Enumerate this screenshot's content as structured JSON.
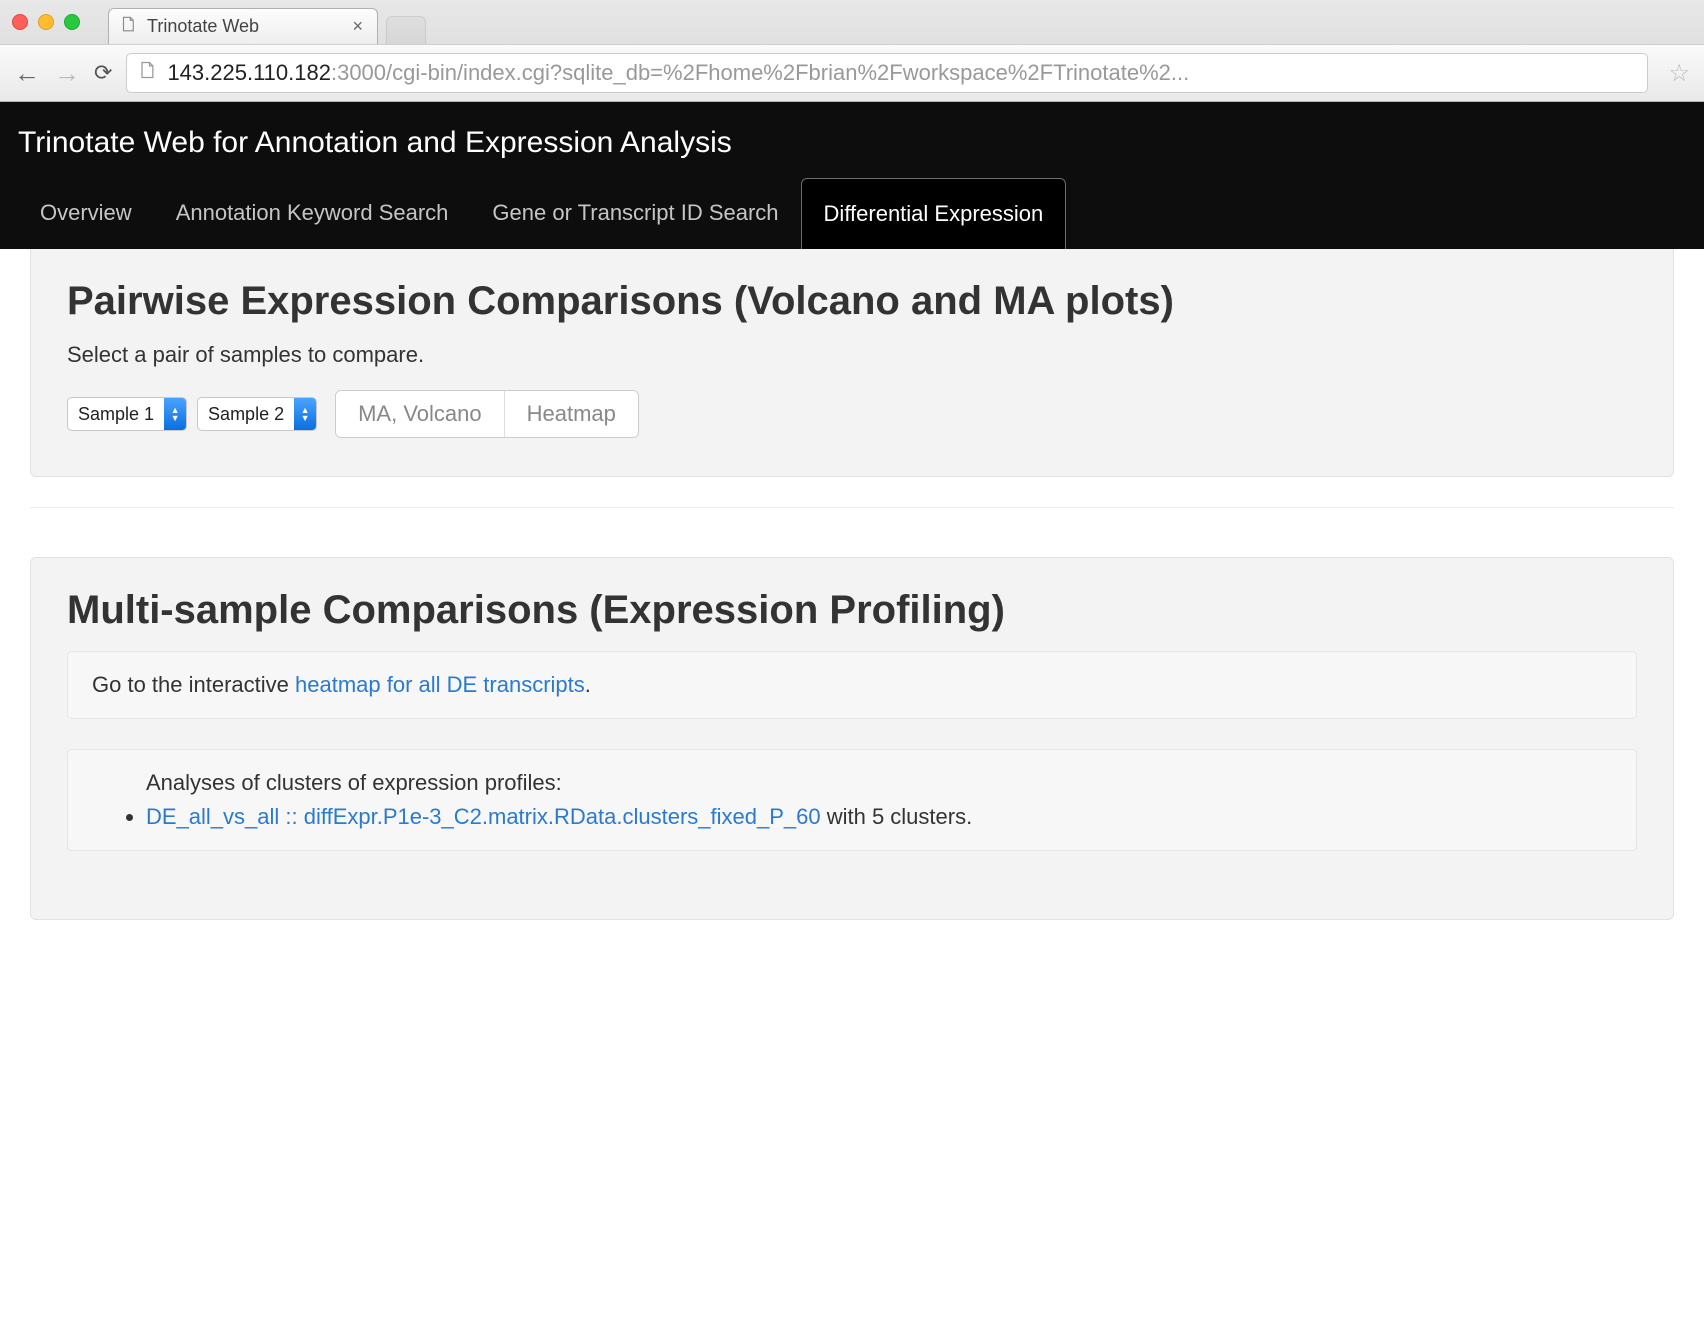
{
  "browser": {
    "tab_title": "Trinotate Web",
    "url_host": "143.225.110.182",
    "url_port_path": ":3000/cgi-bin/index.cgi?sqlite_db=%2Fhome%2Fbrian%2Fworkspace%2FTrinotate%2..."
  },
  "header": {
    "title": "Trinotate Web for Annotation and Expression Analysis",
    "nav": {
      "overview": "Overview",
      "keyword": "Annotation Keyword Search",
      "idsearch": "Gene or Transcript ID Search",
      "diffexpr": "Differential Expression"
    }
  },
  "pairwise": {
    "heading": "Pairwise Expression Comparisons (Volcano and MA plots)",
    "subtext": "Select a pair of samples to compare.",
    "select1": "Sample 1",
    "select2": "Sample 2",
    "btn_ma": "MA, Volcano",
    "btn_heatmap": "Heatmap"
  },
  "multi": {
    "heading": "Multi-sample Comparisons (Expression Profiling)",
    "heatmap_prefix": "Go to the interactive ",
    "heatmap_link": "heatmap for all DE transcripts",
    "heatmap_suffix": ".",
    "cluster_title": "Analyses of clusters of expression profiles:",
    "cluster_link": "DE_all_vs_all :: diffExpr.P1e-3_C2.matrix.RData.clusters_fixed_P_60",
    "cluster_suffix": " with 5 clusters."
  }
}
